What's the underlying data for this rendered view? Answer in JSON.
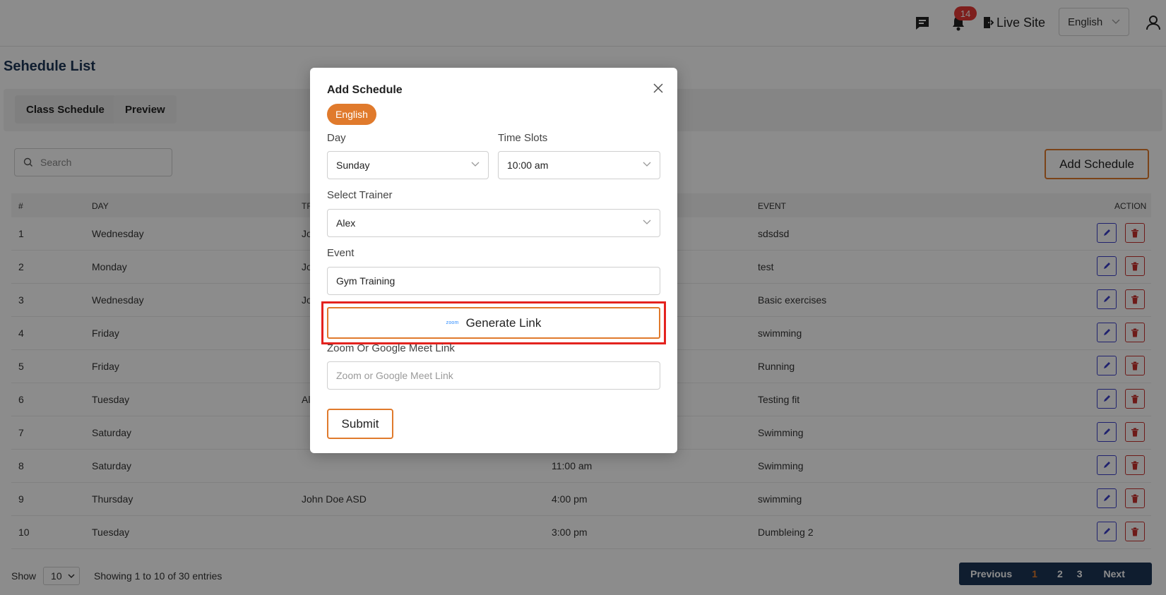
{
  "topbar": {
    "notification_count": "14",
    "live_site_label": "Live Site",
    "language": "English"
  },
  "page": {
    "title": "Sehedule List",
    "tabs": [
      {
        "label": "Class Schedule"
      },
      {
        "label": "Preview"
      }
    ]
  },
  "toolbar": {
    "search_placeholder": "Search",
    "add_button": "Add Schedule"
  },
  "table": {
    "columns": {
      "num": "#",
      "day": "DAY",
      "trainer": "TR",
      "event": "EVENT",
      "action": "ACTION"
    },
    "rows": [
      {
        "num": "1",
        "day": "Wednesday",
        "trainer": "Jo",
        "time": "",
        "event": "sdsdsd"
      },
      {
        "num": "2",
        "day": "Monday",
        "trainer": "Jo",
        "time": "",
        "event": "test"
      },
      {
        "num": "3",
        "day": "Wednesday",
        "trainer": "Jo",
        "time": "",
        "event": "Basic exercises"
      },
      {
        "num": "4",
        "day": "Friday",
        "trainer": "",
        "time": "",
        "event": "swimming"
      },
      {
        "num": "5",
        "day": "Friday",
        "trainer": "",
        "time": "",
        "event": "Running"
      },
      {
        "num": "6",
        "day": "Tuesday",
        "trainer": "Al",
        "time": "",
        "event": "Testing fit"
      },
      {
        "num": "7",
        "day": "Saturday",
        "trainer": "",
        "time": "",
        "event": "Swimming"
      },
      {
        "num": "8",
        "day": "Saturday",
        "trainer": "",
        "time": "11:00 am",
        "event": "Swimming"
      },
      {
        "num": "9",
        "day": "Thursday",
        "trainer": "John Doe ASD",
        "time": "4:00 pm",
        "event": "swimming"
      },
      {
        "num": "10",
        "day": "Tuesday",
        "trainer": "",
        "time": "3:00 pm",
        "event": "Dumbleing 2"
      }
    ]
  },
  "footer": {
    "show_label": "Show",
    "page_size": "10",
    "info": "Showing 1 to 10 of 30 entries",
    "pager": {
      "prev": "Previous",
      "pages": [
        "1",
        "2",
        "3"
      ],
      "next": "Next",
      "current": "1"
    }
  },
  "modal": {
    "title": "Add Schedule",
    "language_chip": "English",
    "day_label": "Day",
    "day_value": "Sunday",
    "time_label": "Time Slots",
    "time_value": "10:00 am",
    "trainer_label": "Select Trainer",
    "trainer_value": "Alex",
    "event_label": "Event",
    "event_value": "Gym Training",
    "zoom_logo_text": "zoom",
    "generate_link": "Generate Link",
    "link_label": "Zoom Or Google Meet Link",
    "link_placeholder": "Zoom or Google Meet Link",
    "submit": "Submit"
  },
  "colors": {
    "accent": "#e07a2c",
    "navy": "#1c3557",
    "highlight": "#e4231f",
    "edit": "#3b3ec9",
    "delete": "#c9302c"
  }
}
